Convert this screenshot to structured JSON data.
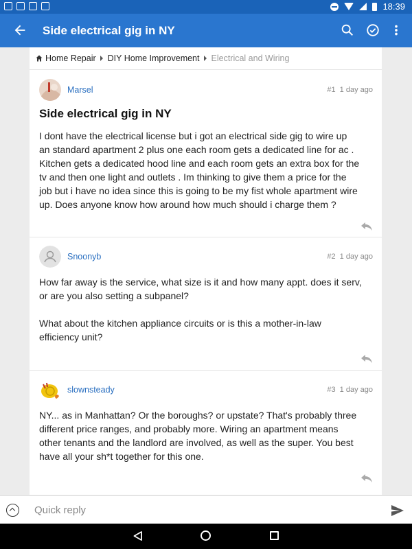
{
  "status_bar": {
    "time": "18:39"
  },
  "app_bar": {
    "title": "Side electrical gig in NY",
    "icons": [
      "back-arrow-icon",
      "search-icon",
      "check-circle-icon",
      "more-vert-icon"
    ]
  },
  "breadcrumb": {
    "items": [
      "Home Repair",
      "DIY Home Improvement"
    ],
    "current": "Electrical and Wiring"
  },
  "thread_title": "Side electrical gig in NY",
  "posts": [
    {
      "author": "Marsel",
      "number": "#1",
      "time": "1 day ago",
      "body": "I dont have the electrical license but i got an electrical side gig to wire up\nan standard apartment 2 plus one each room gets a dedicated line for ac .\nKitchen gets a dedicated hood line and each room gets an extra box for the\ntv and then one light and outlets . Im thinking to give them a price for the\njob but i have no idea since this is going to be my fist whole apartment wire\nup. Does anyone know how around how much should i charge them ?"
    },
    {
      "author": "Snoonyb",
      "number": "#2",
      "time": "1 day ago",
      "body": "How far away is the service, what size is it and how many appt. does it serv,\nor are you also setting a subpanel?\n\nWhat about the kitchen appliance circuits or is this a mother-in-law\nefficiency unit?"
    },
    {
      "author": "slownsteady",
      "number": "#3",
      "time": "1 day ago",
      "body": "NY... as in Manhattan? Or the boroughs? or upstate? That's probably three\ndifferent price ranges, and probably more. Wiring an apartment means\nother tenants and the landlord are involved, as well as the super. You best\nhave all your sh*t together for this one."
    }
  ],
  "quick_reply": {
    "placeholder": "Quick reply"
  },
  "colors": {
    "status_bar": "#1a63b8",
    "app_bar": "#2a76cf",
    "link": "#2a6fc0"
  }
}
